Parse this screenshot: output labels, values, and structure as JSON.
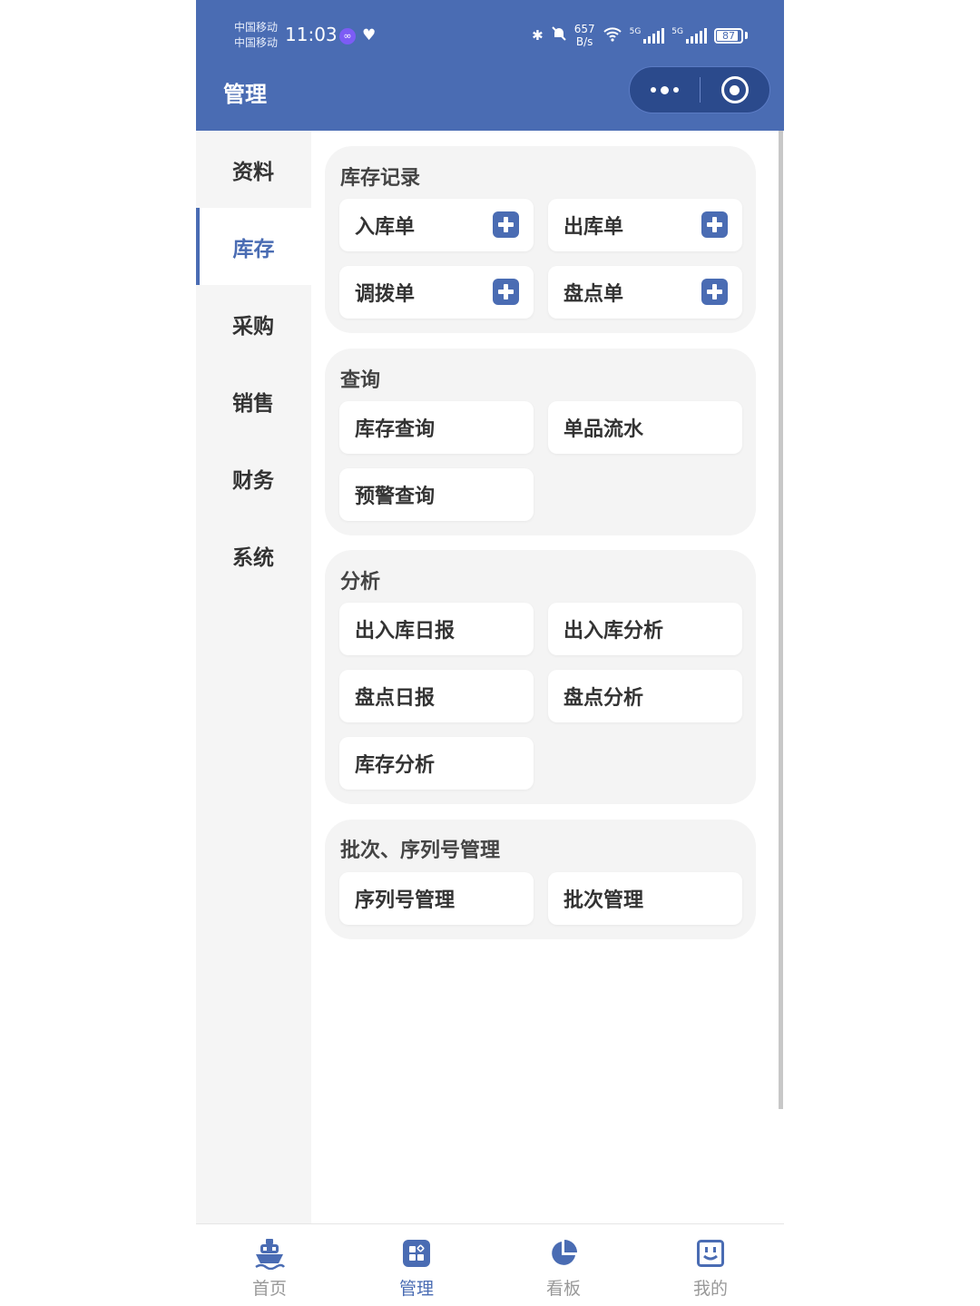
{
  "status_bar": {
    "carrier_line1": "中国移动",
    "carrier_line2": "中国移动",
    "time": "11:03",
    "net_speed_value": "657",
    "net_speed_unit": "B/s",
    "signal_tag": "5G",
    "battery": "87"
  },
  "header": {
    "title": "管理",
    "background_color": "#4a6cb3"
  },
  "sidebar": {
    "items": [
      {
        "label": "资料",
        "active": false
      },
      {
        "label": "库存",
        "active": true
      },
      {
        "label": "采购",
        "active": false
      },
      {
        "label": "销售",
        "active": false
      },
      {
        "label": "财务",
        "active": false
      },
      {
        "label": "系统",
        "active": false
      }
    ]
  },
  "sections": [
    {
      "title": "库存记录",
      "items": [
        {
          "label": "入库单",
          "icon": "plus-icon"
        },
        {
          "label": "出库单",
          "icon": "plus-icon"
        },
        {
          "label": "调拨单",
          "icon": "plus-icon"
        },
        {
          "label": "盘点单",
          "icon": "plus-icon"
        }
      ]
    },
    {
      "title": "查询",
      "items": [
        {
          "label": "库存查询"
        },
        {
          "label": "单品流水"
        },
        {
          "label": "预警查询"
        }
      ]
    },
    {
      "title": "分析",
      "items": [
        {
          "label": "出入库日报"
        },
        {
          "label": "出入库分析"
        },
        {
          "label": "盘点日报"
        },
        {
          "label": "盘点分析"
        },
        {
          "label": "库存分析"
        }
      ]
    },
    {
      "title": "批次、序列号管理",
      "items": [
        {
          "label": "序列号管理"
        },
        {
          "label": "批次管理"
        }
      ]
    }
  ],
  "tabbar": {
    "items": [
      {
        "label": "首页",
        "icon": "ship-icon",
        "active": false
      },
      {
        "label": "管理",
        "icon": "grid-icon",
        "active": true
      },
      {
        "label": "看板",
        "icon": "pie-chart-icon",
        "active": false
      },
      {
        "label": "我的",
        "icon": "profile-icon",
        "active": false
      }
    ]
  },
  "colors": {
    "accent": "#4a6cb3",
    "sidebar_bg": "#f5f5f5",
    "group_bg": "#f4f4f4"
  }
}
